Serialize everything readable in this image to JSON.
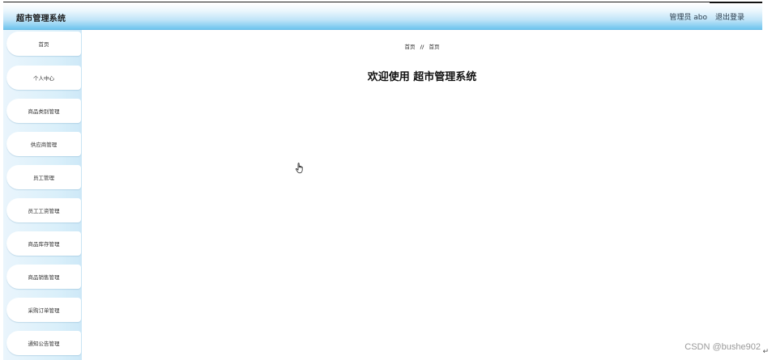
{
  "header": {
    "app_title": "超市管理系统",
    "user_label": "管理员 abo",
    "logout_label": "退出登录"
  },
  "sidebar": {
    "items": [
      {
        "label": "首页"
      },
      {
        "label": "个人中心"
      },
      {
        "label": "商品类别管理"
      },
      {
        "label": "供应商管理"
      },
      {
        "label": "员工管理"
      },
      {
        "label": "员工工资管理"
      },
      {
        "label": "商品库存管理"
      },
      {
        "label": "商品销售管理"
      },
      {
        "label": "采购订单管理"
      },
      {
        "label": "通知公告管理"
      }
    ]
  },
  "main": {
    "breadcrumb": {
      "home": "首页",
      "separator": "//",
      "current": "首页"
    },
    "welcome": "欢迎使用 超市管理系统"
  },
  "watermark": "CSDN @bushe902",
  "colors": {
    "header_top": "#ffffff",
    "header_bottom": "#6ec4ee",
    "sidebar_bg": "#d9effa",
    "menu_item_bg": "#ffffff"
  },
  "icons": {
    "cursor": "hand-pointer-icon",
    "return": "return-arrow-icon"
  }
}
